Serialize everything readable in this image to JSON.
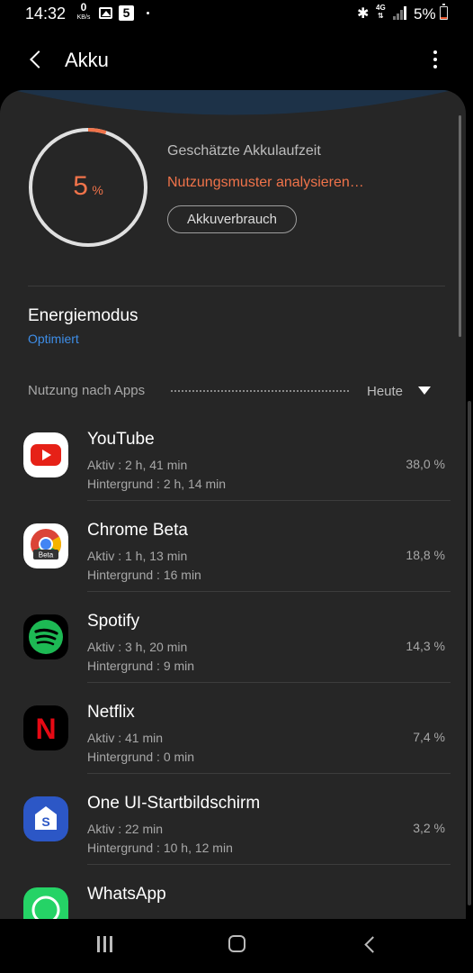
{
  "status_bar": {
    "time": "14:32",
    "net_speed_value": "0",
    "net_speed_unit": "KB/s",
    "notification_badge": "5",
    "network": "4G",
    "battery_percent": "5%"
  },
  "header": {
    "title": "Akku"
  },
  "battery": {
    "level": 5,
    "level_number": "5",
    "level_symbol": "%",
    "estimate_label": "Geschätzte Akkulaufzeit",
    "estimate_status": "Nutzungsmuster analysieren…",
    "usage_button": "Akkuverbrauch",
    "accent_color": "#f0734a"
  },
  "power_mode": {
    "title": "Energiemodus",
    "value": "Optimiert"
  },
  "usage": {
    "header": "Nutzung nach Apps",
    "period": "Heute",
    "apps": [
      {
        "name": "YouTube",
        "active": "Aktiv : 2 h, 41 min",
        "background": "Hintergrund : 2 h, 14 min",
        "percent": "38,0 %",
        "icon": "youtube-icon"
      },
      {
        "name": "Chrome Beta",
        "active": "Aktiv : 1 h, 13 min",
        "background": "Hintergrund : 16 min",
        "percent": "18,8 %",
        "icon": "chrome-beta-icon",
        "icon_badge": "Beta"
      },
      {
        "name": "Spotify",
        "active": "Aktiv : 3 h, 20 min",
        "background": "Hintergrund : 9 min",
        "percent": "14,3 %",
        "icon": "spotify-icon"
      },
      {
        "name": "Netflix",
        "active": "Aktiv : 41 min",
        "background": "Hintergrund : 0 min",
        "percent": "7,4 %",
        "icon": "netflix-icon",
        "icon_letter": "N"
      },
      {
        "name": "One UI-Startbildschirm",
        "active": "Aktiv : 22 min",
        "background": "Hintergrund : 10 h, 12 min",
        "percent": "3,2 %",
        "icon": "one-ui-home-icon",
        "icon_letter": "S"
      },
      {
        "name": "WhatsApp",
        "active": "",
        "background": "",
        "percent": "",
        "icon": "whatsapp-icon"
      }
    ]
  }
}
